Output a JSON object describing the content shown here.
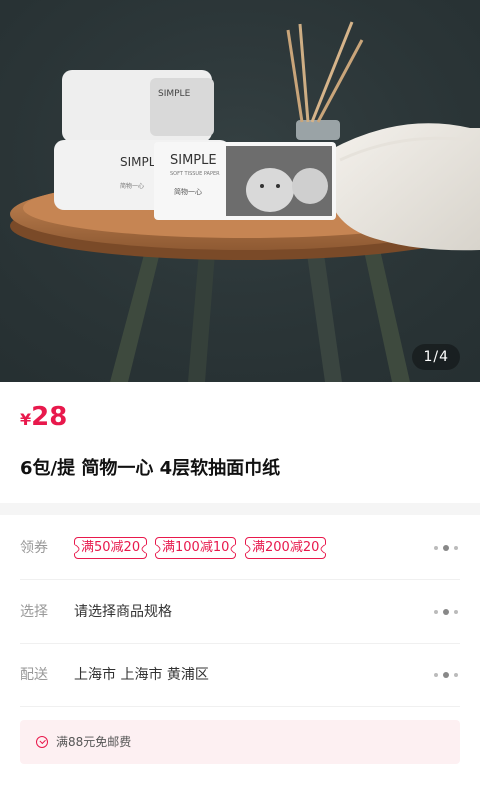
{
  "gallery": {
    "counter": "1/4",
    "brand_text": "SIMPLE",
    "pack_subtext": "SOFT TISSUE PAPER",
    "pack_cn": "简物一心"
  },
  "product": {
    "currency": "¥",
    "price": "28",
    "title": "6包/提 简物一心 4层软抽面巾纸"
  },
  "rows": {
    "coupon": {
      "label": "领券",
      "items": [
        "满50减20",
        "满100减10",
        "满200减20"
      ]
    },
    "spec": {
      "label": "选择",
      "value": "请选择商品规格"
    },
    "delivery": {
      "label": "配送",
      "value": "上海市 上海市 黄浦区"
    }
  },
  "notice": {
    "text": "满88元免邮费",
    "icon": "check-circle-icon"
  },
  "colors": {
    "accent": "#e8194c",
    "notice_bg": "#fdf0f2",
    "label": "#999999"
  }
}
